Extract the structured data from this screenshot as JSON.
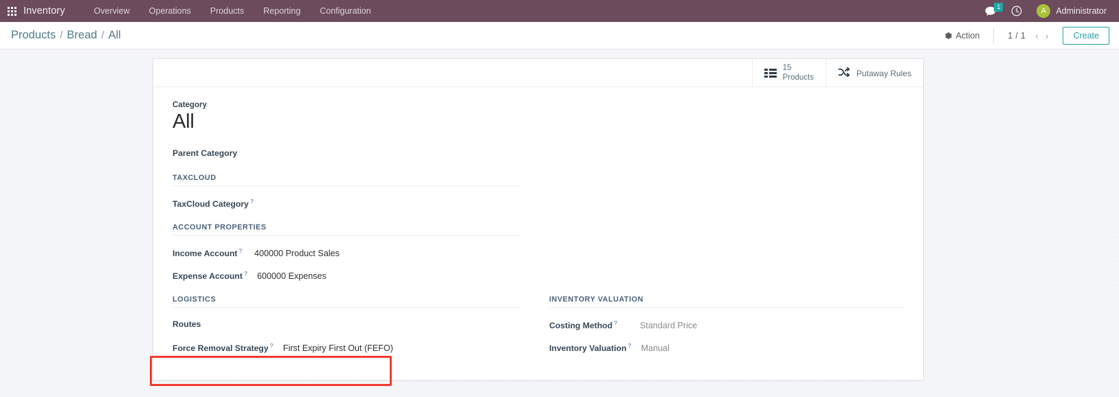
{
  "navbar": {
    "apps_icon": "apps-grid-icon",
    "brand": "Inventory",
    "menu": [
      {
        "label": "Overview"
      },
      {
        "label": "Operations"
      },
      {
        "label": "Products"
      },
      {
        "label": "Reporting"
      },
      {
        "label": "Configuration"
      }
    ],
    "messages_icon": "chat-bubble-icon",
    "messages_count": "1",
    "activity_icon": "clock-icon",
    "avatar_initial": "A",
    "user_name": "Administrator",
    "background_color": "#6b4b5c",
    "badge_color": "#20a6a6",
    "avatar_color": "#a8c33a"
  },
  "control_panel": {
    "breadcrumb": [
      {
        "label": "Products",
        "current": false
      },
      {
        "label": "Bread",
        "current": false
      },
      {
        "label": "All",
        "current": true
      }
    ],
    "breadcrumb_separator": "/",
    "action_icon": "gear-icon",
    "action_label": "Action",
    "pager_value": "1 / 1",
    "prev_icon": "chevron-left-icon",
    "next_icon": "chevron-right-icon",
    "create_label": "Create",
    "create_color": "#21a0a0"
  },
  "smart_buttons": [
    {
      "icon": "list-icon",
      "value": "15",
      "label": "Products"
    },
    {
      "icon": "shuffle-icon",
      "label": "Putaway Rules"
    }
  ],
  "form": {
    "title_label": "Category",
    "title": "All",
    "parent_category": {
      "label": "Parent Category",
      "value": ""
    },
    "taxcloud": {
      "section": "TAXCLOUD",
      "fields": [
        {
          "label": "TaxCloud Category",
          "tooltip": "?",
          "value": ""
        }
      ]
    },
    "account_properties": {
      "section": "ACCOUNT PROPERTIES",
      "fields": [
        {
          "label": "Income Account",
          "tooltip": "?",
          "value": "400000 Product Sales"
        },
        {
          "label": "Expense Account",
          "tooltip": "?",
          "value": "600000 Expenses"
        }
      ]
    },
    "logistics": {
      "section": "LOGISTICS",
      "routes_label": "Routes",
      "routes_value": "",
      "force_removal_label": "Force Removal Strategy",
      "force_removal_tooltip": "?",
      "force_removal_value": "First Expiry First Out (FEFO)"
    },
    "inventory_valuation": {
      "section": "INVENTORY VALUATION",
      "costing_method_label": "Costing Method",
      "costing_method_tooltip": "?",
      "costing_method_value": "Standard Price",
      "inventory_valuation_label": "Inventory Valuation",
      "inventory_valuation_tooltip": "?",
      "inventory_valuation_value": "Manual"
    }
  },
  "annotation": {
    "highlight_color": "#f23b2f",
    "target": "force-removal-strategy-field"
  }
}
